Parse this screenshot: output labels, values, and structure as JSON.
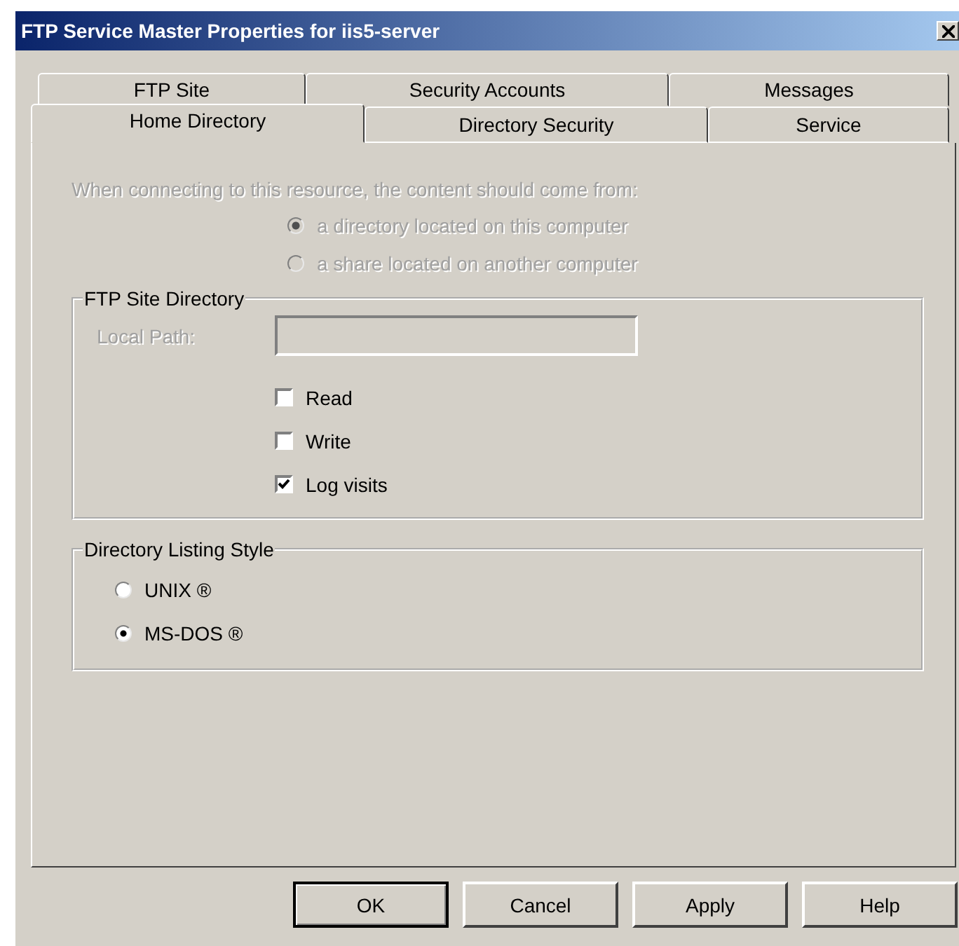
{
  "window": {
    "title": "FTP Service Master Properties for iis5-server"
  },
  "tab_rows": [
    [
      {
        "label": "FTP Site",
        "selected": false
      },
      {
        "label": "Security Accounts",
        "selected": false
      },
      {
        "label": "Messages",
        "selected": false
      }
    ],
    [
      {
        "label": "Home Directory",
        "selected": true
      },
      {
        "label": "Directory Security",
        "selected": false
      },
      {
        "label": "Service",
        "selected": false
      }
    ]
  ],
  "content_source": {
    "prompt": "When connecting to this resource, the content should come from:",
    "disabled": true,
    "options": [
      {
        "label": "a directory located on this computer",
        "selected": true
      },
      {
        "label": "a share located on another computer",
        "selected": false
      }
    ]
  },
  "ftp_site_directory": {
    "title": "FTP Site Directory",
    "local_path": {
      "label": "Local Path:",
      "disabled": true
    },
    "checkboxes": [
      {
        "label": "Read",
        "checked": false
      },
      {
        "label": "Write",
        "checked": false
      },
      {
        "label": "Log visits",
        "checked": true
      }
    ]
  },
  "directory_listing_style": {
    "title": "Directory Listing Style",
    "options": [
      {
        "label": "UNIX ®",
        "selected": false
      },
      {
        "label": "MS-DOS ®",
        "selected": true
      }
    ]
  },
  "buttons": [
    {
      "label": "OK",
      "default": true
    },
    {
      "label": "Cancel",
      "default": false
    },
    {
      "label": "Apply",
      "default": false
    },
    {
      "label": "Help",
      "default": false
    }
  ]
}
